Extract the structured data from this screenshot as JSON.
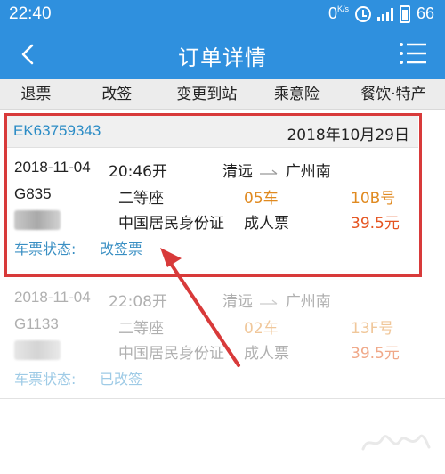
{
  "status_bar": {
    "time": "22:40",
    "net_speed": "0",
    "net_unit": "K/s",
    "battery": "66",
    "icons": [
      "alarm-icon",
      "signal-icon",
      "battery-icon"
    ]
  },
  "header": {
    "title": "订单详情",
    "back_icon": "chevron-left-icon",
    "menu_icon": "menu-icon"
  },
  "actions": [
    "退票",
    "改签",
    "变更到站",
    "乘意险",
    "餐饮·特产"
  ],
  "order": {
    "number": "EK63759343",
    "date": "2018年10月29日"
  },
  "tickets": [
    {
      "date": "2018-11-04",
      "time": "20:46开",
      "from": "清远",
      "to": "广州南",
      "train": "G835",
      "seat_class": "二等座",
      "car": "05车",
      "seat": "10B号",
      "id_type": "中国居民身份证",
      "ticket_type": "成人票",
      "price": "39.5元",
      "status_label": "车票状态:",
      "status_value": "改签票"
    },
    {
      "date": "2018-11-04",
      "time": "22:08开",
      "from": "清远",
      "to": "广州南",
      "train": "G1133",
      "seat_class": "二等座",
      "car": "02车",
      "seat": "13F号",
      "id_type": "中国居民身份证",
      "ticket_type": "成人票",
      "price": "39.5元",
      "status_label": "车票状态:",
      "status_value": "已改签"
    }
  ],
  "colors": {
    "primary": "#2f90de",
    "highlight": "#d83a3a",
    "car": "#e08a20",
    "price": "#e55420",
    "status": "#3a8fc3"
  }
}
